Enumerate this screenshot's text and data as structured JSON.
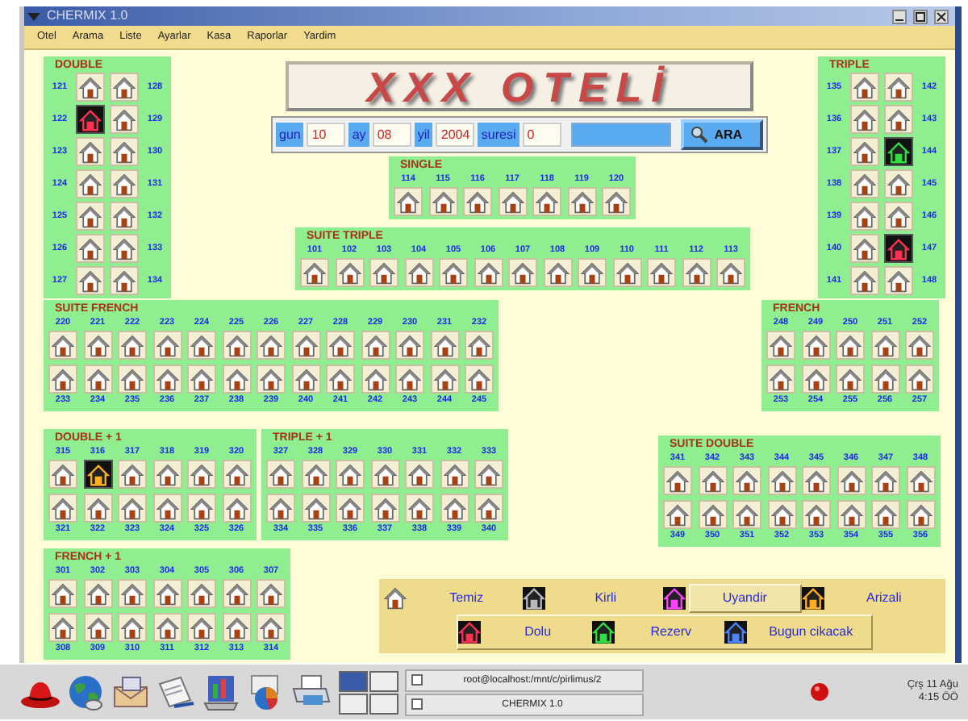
{
  "window": {
    "title": "CHERMIX 1.0"
  },
  "menu": [
    "Otel",
    "Arama",
    "Liste",
    "Ayarlar",
    "Kasa",
    "Raporlar",
    "Yardim"
  ],
  "logo": "XXX OTELİ",
  "search": {
    "fields": [
      {
        "label": "gun",
        "value": "10"
      },
      {
        "label": "ay",
        "value": "08"
      },
      {
        "label": "yil",
        "value": "2004"
      },
      {
        "label": "suresi",
        "value": "0"
      }
    ],
    "button": "ARA"
  },
  "sections": [
    {
      "title": "DOUBLE",
      "kind": "columns",
      "lines": [
        [
          {
            "number": "121",
            "kind": "temiz"
          },
          {
            "number": "122",
            "kind": "dolu"
          },
          {
            "number": "123",
            "kind": "temiz"
          },
          {
            "number": "124",
            "kind": "temiz"
          },
          {
            "number": "125",
            "kind": "temiz"
          },
          {
            "number": "126",
            "kind": "temiz"
          },
          {
            "number": "127",
            "kind": "temiz"
          }
        ],
        [
          {
            "number": "128",
            "kind": "temiz"
          },
          {
            "number": "129",
            "kind": "temiz"
          },
          {
            "number": "130",
            "kind": "temiz"
          },
          {
            "number": "131",
            "kind": "temiz"
          },
          {
            "number": "132",
            "kind": "temiz"
          },
          {
            "number": "133",
            "kind": "temiz"
          },
          {
            "number": "134",
            "kind": "temiz"
          }
        ]
      ]
    },
    {
      "title": "SINGLE",
      "kind": "rows",
      "lines": [
        [
          {
            "number": "114",
            "kind": "temiz"
          },
          {
            "number": "115",
            "kind": "temiz"
          },
          {
            "number": "116",
            "kind": "temiz"
          },
          {
            "number": "117",
            "kind": "temiz"
          },
          {
            "number": "118",
            "kind": "temiz"
          },
          {
            "number": "119",
            "kind": "temiz"
          },
          {
            "number": "120",
            "kind": "temiz"
          }
        ]
      ]
    },
    {
      "title": "SUITE TRIPLE",
      "kind": "rows",
      "lines": [
        [
          {
            "number": "101",
            "kind": "temiz"
          },
          {
            "number": "102",
            "kind": "temiz"
          },
          {
            "number": "103",
            "kind": "temiz"
          },
          {
            "number": "104",
            "kind": "temiz"
          },
          {
            "number": "105",
            "kind": "temiz"
          },
          {
            "number": "106",
            "kind": "temiz"
          },
          {
            "number": "107",
            "kind": "temiz"
          },
          {
            "number": "108",
            "kind": "temiz"
          },
          {
            "number": "109",
            "kind": "temiz"
          },
          {
            "number": "110",
            "kind": "temiz"
          },
          {
            "number": "111",
            "kind": "temiz"
          },
          {
            "number": "112",
            "kind": "temiz"
          },
          {
            "number": "113",
            "kind": "temiz"
          }
        ]
      ]
    },
    {
      "title": "TRIPLE",
      "kind": "columns",
      "lines": [
        [
          {
            "number": "135",
            "kind": "temiz"
          },
          {
            "number": "136",
            "kind": "temiz"
          },
          {
            "number": "137",
            "kind": "temiz"
          },
          {
            "number": "138",
            "kind": "temiz"
          },
          {
            "number": "139",
            "kind": "temiz"
          },
          {
            "number": "140",
            "kind": "temiz"
          },
          {
            "number": "141",
            "kind": "temiz"
          }
        ],
        [
          {
            "number": "142",
            "kind": "temiz"
          },
          {
            "number": "143",
            "kind": "temiz"
          },
          {
            "number": "144",
            "kind": "rezerv"
          },
          {
            "number": "145",
            "kind": "temiz"
          },
          {
            "number": "146",
            "kind": "temiz"
          },
          {
            "number": "147",
            "kind": "dolu"
          },
          {
            "number": "148",
            "kind": "temiz"
          }
        ]
      ]
    },
    {
      "title": "SUITE FRENCH",
      "kind": "rows",
      "lines": [
        [
          {
            "number": "220",
            "kind": "temiz"
          },
          {
            "number": "221",
            "kind": "temiz"
          },
          {
            "number": "222",
            "kind": "temiz"
          },
          {
            "number": "223",
            "kind": "temiz"
          },
          {
            "number": "224",
            "kind": "temiz"
          },
          {
            "number": "225",
            "kind": "temiz"
          },
          {
            "number": "226",
            "kind": "temiz"
          },
          {
            "number": "227",
            "kind": "temiz"
          },
          {
            "number": "228",
            "kind": "temiz"
          },
          {
            "number": "229",
            "kind": "temiz"
          },
          {
            "number": "230",
            "kind": "temiz"
          },
          {
            "number": "231",
            "kind": "temiz"
          },
          {
            "number": "232",
            "kind": "temiz"
          }
        ],
        [
          {
            "number": "233",
            "kind": "temiz"
          },
          {
            "number": "234",
            "kind": "temiz"
          },
          {
            "number": "235",
            "kind": "temiz"
          },
          {
            "number": "236",
            "kind": "temiz"
          },
          {
            "number": "237",
            "kind": "temiz"
          },
          {
            "number": "238",
            "kind": "temiz"
          },
          {
            "number": "239",
            "kind": "temiz"
          },
          {
            "number": "240",
            "kind": "temiz"
          },
          {
            "number": "241",
            "kind": "temiz"
          },
          {
            "number": "242",
            "kind": "temiz"
          },
          {
            "number": "243",
            "kind": "temiz"
          },
          {
            "number": "244",
            "kind": "temiz"
          },
          {
            "number": "245",
            "kind": "temiz"
          }
        ]
      ]
    },
    {
      "title": "FRENCH",
      "kind": "rows",
      "lines": [
        [
          {
            "number": "248",
            "kind": "temiz"
          },
          {
            "number": "249",
            "kind": "temiz"
          },
          {
            "number": "250",
            "kind": "temiz"
          },
          {
            "number": "251",
            "kind": "temiz"
          },
          {
            "number": "252",
            "kind": "temiz"
          }
        ],
        [
          {
            "number": "253",
            "kind": "temiz"
          },
          {
            "number": "254",
            "kind": "temiz"
          },
          {
            "number": "255",
            "kind": "temiz"
          },
          {
            "number": "256",
            "kind": "temiz"
          },
          {
            "number": "257",
            "kind": "temiz"
          }
        ]
      ]
    },
    {
      "title": "DOUBLE + 1",
      "kind": "rows",
      "lines": [
        [
          {
            "number": "315",
            "kind": "temiz"
          },
          {
            "number": "316",
            "kind": "arizali"
          },
          {
            "number": "317",
            "kind": "temiz"
          },
          {
            "number": "318",
            "kind": "temiz"
          },
          {
            "number": "319",
            "kind": "temiz"
          },
          {
            "number": "320",
            "kind": "temiz"
          }
        ],
        [
          {
            "number": "321",
            "kind": "temiz"
          },
          {
            "number": "322",
            "kind": "temiz"
          },
          {
            "number": "323",
            "kind": "temiz"
          },
          {
            "number": "324",
            "kind": "temiz"
          },
          {
            "number": "325",
            "kind": "temiz"
          },
          {
            "number": "326",
            "kind": "temiz"
          }
        ]
      ]
    },
    {
      "title": "TRIPLE + 1",
      "kind": "rows",
      "lines": [
        [
          {
            "number": "327",
            "kind": "temiz"
          },
          {
            "number": "328",
            "kind": "temiz"
          },
          {
            "number": "329",
            "kind": "temiz"
          },
          {
            "number": "330",
            "kind": "temiz"
          },
          {
            "number": "331",
            "kind": "temiz"
          },
          {
            "number": "332",
            "kind": "temiz"
          },
          {
            "number": "333",
            "kind": "temiz"
          }
        ],
        [
          {
            "number": "334",
            "kind": "temiz"
          },
          {
            "number": "335",
            "kind": "temiz"
          },
          {
            "number": "336",
            "kind": "temiz"
          },
          {
            "number": "337",
            "kind": "temiz"
          },
          {
            "number": "338",
            "kind": "temiz"
          },
          {
            "number": "339",
            "kind": "temiz"
          },
          {
            "number": "340",
            "kind": "temiz"
          }
        ]
      ]
    },
    {
      "title": "SUITE DOUBLE",
      "kind": "rows",
      "lines": [
        [
          {
            "number": "341",
            "kind": "temiz"
          },
          {
            "number": "342",
            "kind": "temiz"
          },
          {
            "number": "343",
            "kind": "temiz"
          },
          {
            "number": "344",
            "kind": "temiz"
          },
          {
            "number": "345",
            "kind": "temiz"
          },
          {
            "number": "346",
            "kind": "temiz"
          },
          {
            "number": "347",
            "kind": "temiz"
          },
          {
            "number": "348",
            "kind": "temiz"
          }
        ],
        [
          {
            "number": "349",
            "kind": "temiz"
          },
          {
            "number": "350",
            "kind": "temiz"
          },
          {
            "number": "351",
            "kind": "temiz"
          },
          {
            "number": "352",
            "kind": "temiz"
          },
          {
            "number": "353",
            "kind": "temiz"
          },
          {
            "number": "354",
            "kind": "temiz"
          },
          {
            "number": "355",
            "kind": "temiz"
          },
          {
            "number": "356",
            "kind": "temiz"
          }
        ]
      ]
    },
    {
      "title": "FRENCH + 1",
      "kind": "rows",
      "lines": [
        [
          {
            "number": "301",
            "kind": "temiz"
          },
          {
            "number": "302",
            "kind": "temiz"
          },
          {
            "number": "303",
            "kind": "temiz"
          },
          {
            "number": "304",
            "kind": "temiz"
          },
          {
            "number": "305",
            "kind": "temiz"
          },
          {
            "number": "306",
            "kind": "temiz"
          },
          {
            "number": "307",
            "kind": "temiz"
          }
        ],
        [
          {
            "number": "308",
            "kind": "temiz"
          },
          {
            "number": "309",
            "kind": "temiz"
          },
          {
            "number": "310",
            "kind": "temiz"
          },
          {
            "number": "311",
            "kind": "temiz"
          },
          {
            "number": "312",
            "kind": "temiz"
          },
          {
            "number": "313",
            "kind": "temiz"
          },
          {
            "number": "314",
            "kind": "temiz"
          }
        ]
      ]
    }
  ],
  "legend": [
    [
      {
        "label": "Temiz",
        "kind": "temiz",
        "selected": false
      },
      {
        "label": "Kirli",
        "kind": "kirli",
        "selected": false
      },
      {
        "label": "Uyandir",
        "kind": "uyandir",
        "selected": true
      },
      {
        "label": "Arizali",
        "kind": "arizali",
        "selected": false
      }
    ],
    [
      {
        "label": "Dolu",
        "kind": "dolu",
        "selected": false
      },
      {
        "label": "Rezerv",
        "kind": "rezerv",
        "selected": false
      },
      {
        "label": "Bugun cikacak",
        "kind": "bugun_cikacak",
        "selected": false
      }
    ]
  ],
  "taskbar": {
    "tasks": [
      "root@localhost:/mnt/c/pirlimus/2",
      "CHERMIX 1.0"
    ],
    "date": "Çrş 11 Ağu",
    "time": "4:15 ÖÖ"
  }
}
